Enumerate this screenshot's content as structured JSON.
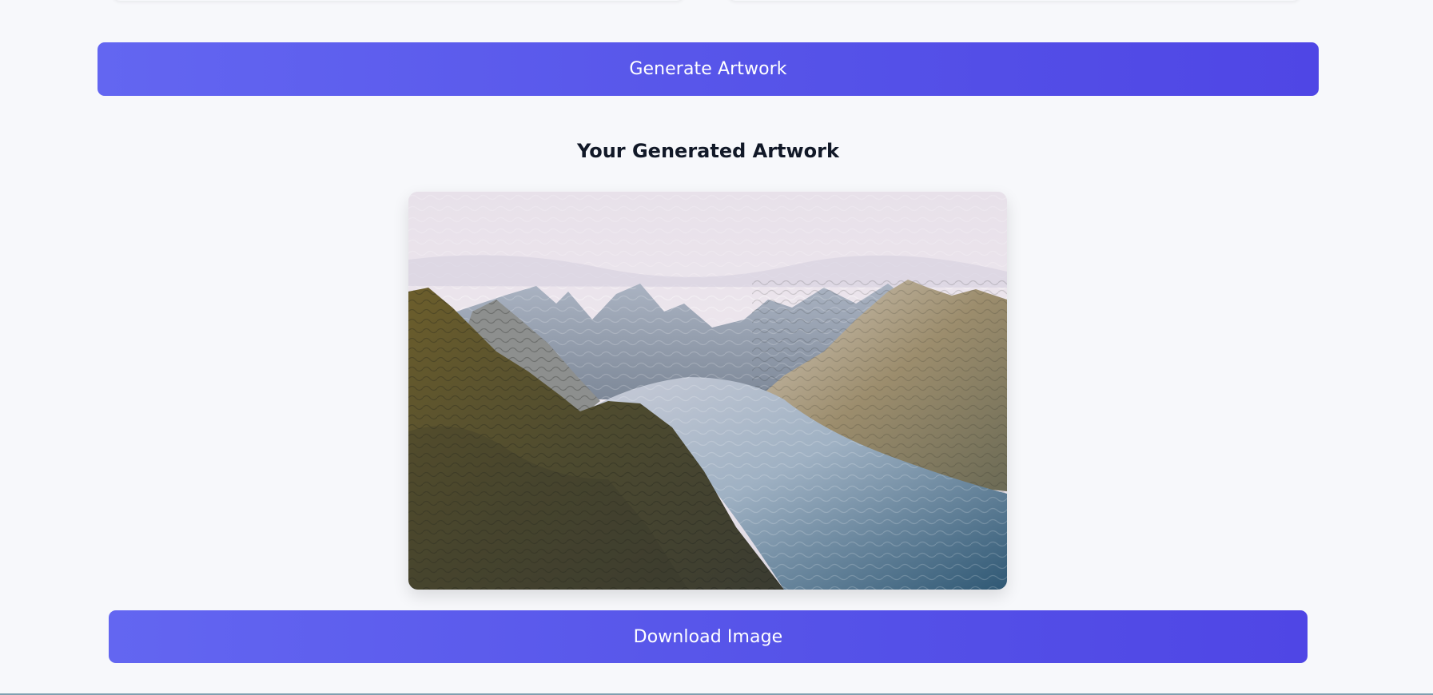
{
  "actions": {
    "generate_label": "Generate Artwork",
    "download_label": "Download Image"
  },
  "result": {
    "title": "Your Generated Artwork",
    "image_description": ""
  },
  "colors": {
    "page_background": "#f7f8fb",
    "button_gradient_start": "#6366f1",
    "button_gradient_end": "#4f46e5",
    "title_text": "#111827"
  }
}
